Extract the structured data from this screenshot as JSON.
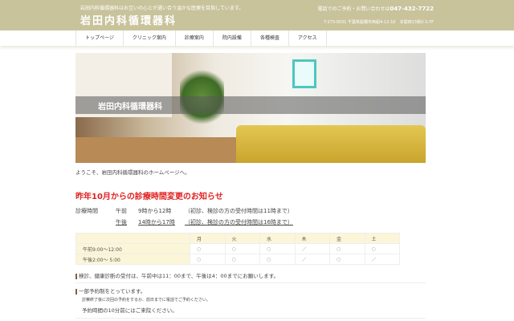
{
  "header": {
    "tagline": "岩田内科循環器科はお互いの心とが通い合う温かな医療を目指しています。",
    "logo": "岩田内科循環器科",
    "phone_label": "電話でのご予約・お問い合わせは",
    "phone": "047-432-7722",
    "address": "〒273-0031 千葉県船橋市西船4-12-10　本間田13相ビル7F"
  },
  "nav": [
    "トップページ",
    "クリニック案内",
    "診療案内",
    "院内設備",
    "各種検査",
    "アクセス"
  ],
  "hero": {
    "banner": "岩田内科循環器科"
  },
  "welcome": "ようこそ、岩田内科循環器科のホームページへ。",
  "notice_title": "昨年10月からの診療時間変更のお知らせ",
  "hours": {
    "label": "診療時間",
    "am": {
      "period": "午前",
      "time": "9時から12時",
      "note": "（初診、検診の方の受付時間は11時まで）"
    },
    "pm": {
      "period": "午後",
      "time": "14時から17時",
      "note": "（初診、検診の方の受付時間は16時まで）"
    }
  },
  "schedule": {
    "days": [
      "月",
      "火",
      "水",
      "木",
      "金",
      "土"
    ],
    "rows": [
      {
        "label": "午前9:00～12:00",
        "values": [
          "○",
          "○",
          "○",
          "／",
          "○",
          "○"
        ]
      },
      {
        "label": "午後2:00～ 5:00",
        "values": [
          "○",
          "○",
          "○",
          "／",
          "○",
          "／"
        ]
      }
    ]
  },
  "notes": {
    "checkup": "検診、健康診断の受付は、午前中は11：00まで、午後は4：00までにお願いします。",
    "reservation": "一部予約制をとっています。",
    "reservation_detail": "診察終了後に次回の予約をするか、前日までに電話でご予約ください。",
    "arrival": "予約時間の10分前にはご来院ください。"
  },
  "colors": {
    "header": "#c9c39c",
    "notice": "#e02020",
    "table_header": "#fbf6d8"
  }
}
